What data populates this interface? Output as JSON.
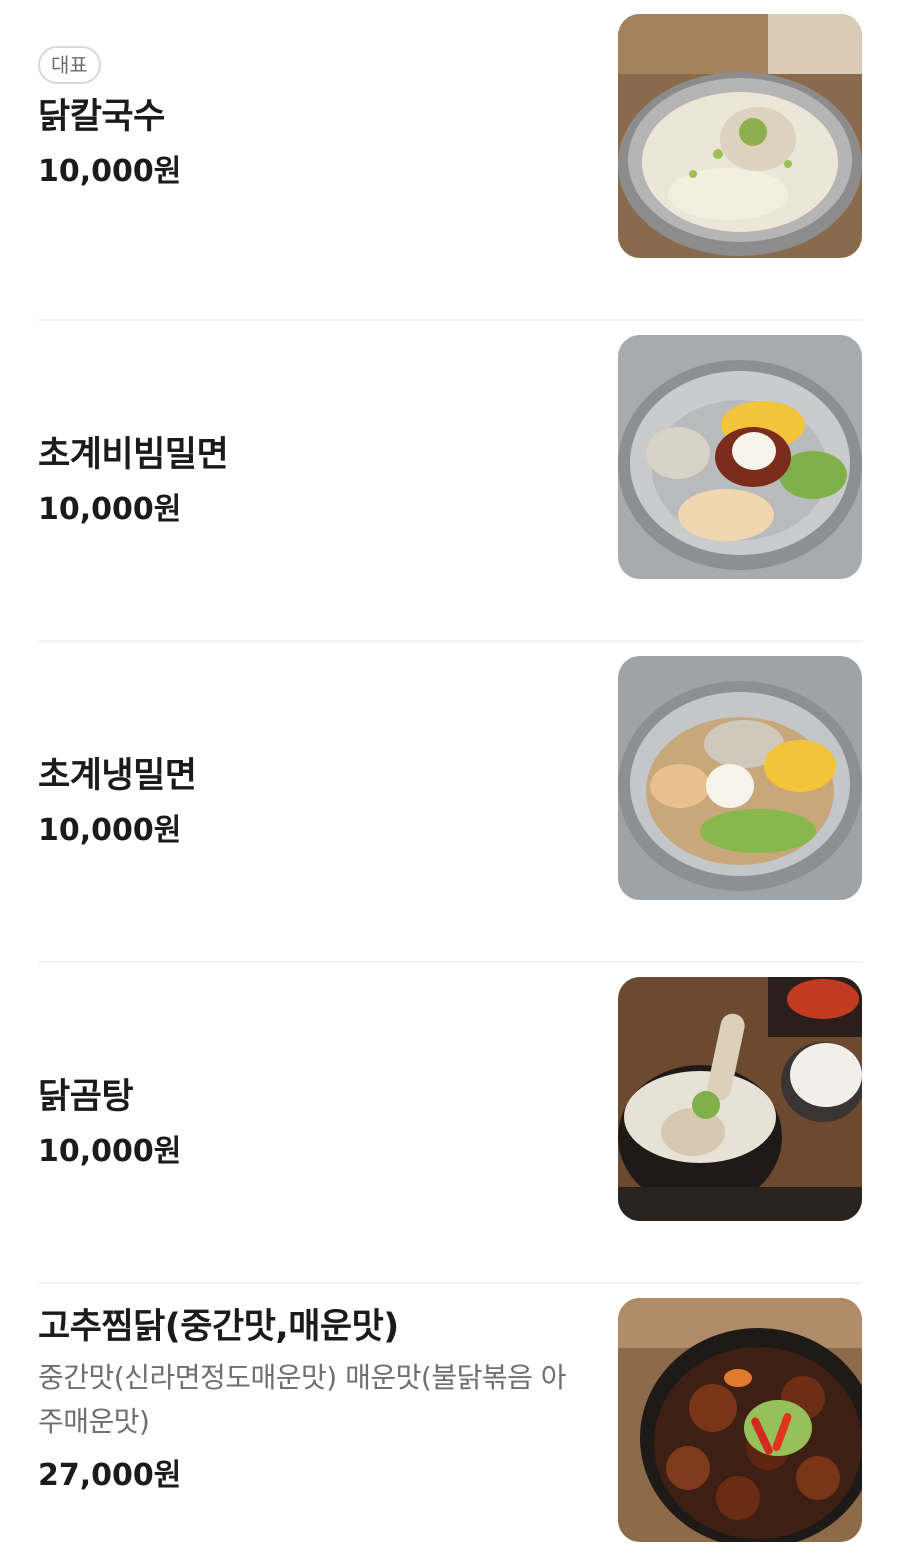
{
  "menu": {
    "items": [
      {
        "badge": "대표",
        "name": "닭칼국수",
        "price": "10,000원"
      },
      {
        "name": "초계비빔밀면",
        "price": "10,000원"
      },
      {
        "name": "초계냉밀면",
        "price": "10,000원"
      },
      {
        "name": "닭곰탕",
        "price": "10,000원"
      },
      {
        "name": "고추찜닭(중간맛,매운맛)",
        "description": "중간맛(신라면정도매운맛) 매운맛(불닭볶음 아주매운맛)",
        "price": "27,000원"
      }
    ]
  },
  "colors": {
    "text": "#1b1b1b",
    "description": "#6f6f6f",
    "badge_border": "#d8d8d8",
    "divider": "#f2f2f2"
  }
}
